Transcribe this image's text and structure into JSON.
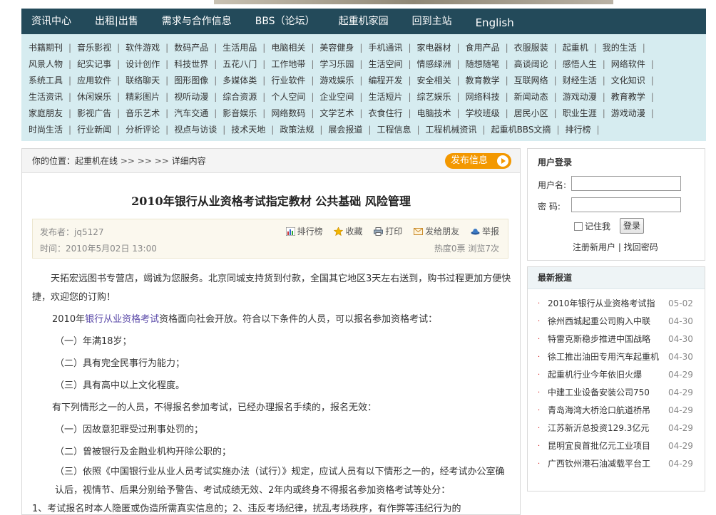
{
  "nav": {
    "items": [
      "资讯中心",
      "出租|出售",
      "需求与合作信息",
      "BBS（论坛）",
      "起重机家园",
      "回到主站",
      "English"
    ]
  },
  "categories": {
    "rows": [
      [
        "书籍期刊",
        "音乐影视",
        "软件游戏",
        "数码产品",
        "生活用品",
        "电脑相关",
        "美容健身",
        "手机通讯",
        "家电器材",
        "食用产品",
        "衣服服装",
        "起重机",
        "我的生活"
      ],
      [
        "风景人物",
        "纪实记事",
        "设计创作",
        "科技世界",
        "五花八门",
        "工作地带",
        "学习乐园",
        "生活空间",
        "情感绿洲",
        "随想随笔",
        "高谈阔论",
        "感悟人生",
        "网络软件"
      ],
      [
        "系统工具",
        "应用软件",
        "联络聊天",
        "图形图像",
        "多媒体类",
        "行业软件",
        "游戏娱乐",
        "编程开发",
        "安全相关",
        "教育教学",
        "互联网络",
        "财经生活",
        "文化知识"
      ],
      [
        "生活资讯",
        "休闲娱乐",
        "精彩图片",
        "视听动漫",
        "综合资源",
        "个人空间",
        "企业空间",
        "生活短片",
        "综艺娱乐",
        "网络科技",
        "新闻动态",
        "游戏动漫",
        "教育教学"
      ],
      [
        "家庭朋友",
        "影视广告",
        "音乐艺术",
        "汽车交通",
        "影音娱乐",
        "网络数码",
        "文学艺术",
        "衣食住行",
        "电脑技术",
        "学校班级",
        "居民小区",
        "职业生涯",
        "游戏动漫"
      ],
      [
        "时尚生活",
        "行业新闻",
        "分析评论",
        "视点与访谈",
        "技术天地",
        "政策法规",
        "展会报道",
        "工程信息",
        "工程机械资讯",
        "起重机BBS文摘",
        "排行榜"
      ]
    ]
  },
  "breadcrumb": {
    "prefix": "你的位置：起重机在线",
    "arrows": ">> >> >>",
    "current": "详细内容"
  },
  "post_button": "发布信息",
  "article": {
    "title": "2010年银行从业资格考试指定教材  公共基础  风险管理",
    "publisher": "发布者：jq5127",
    "time": "时间：2010年5月02日  13:00",
    "actions": [
      "排行榜",
      "收藏",
      "打印",
      "发给朋友",
      "举报"
    ],
    "stats": "热度0票  浏览7次",
    "p1": "天拓宏远图书专营店，竭诚为您服务。北京同城支持货到付款，全国其它地区3天左右送到，购书过程更加方便快捷，欢迎您的订购！",
    "p2_pre": "2010年",
    "p2_link": "银行从业资格考试",
    "p2_post": "资格面向社会开放。符合以下条件的人员，可以报名参加资格考试：",
    "c1": "（一）年满18岁；",
    "c2": "（二）具有完全民事行为能力；",
    "c3": "（三）具有高中以上文化程度。",
    "p3": "有下列情形之一的人员，不得报名参加考试，已经办理报名手续的，报名无效：",
    "d1": "（一）因故意犯罪受过刑事处罚的；",
    "d2": "（二）曾被银行及金融业机构开除公职的；",
    "d3": "（三）依照《中国银行业从业人员考试实施办法（试行）》规定，应试人员有以下情形之一的，经考试办公室确认后，视情节、后果分别给予警告、考试成绩无效、2年内或终身不得报名参加资格考试等处分：",
    "d4": "1、考试报名时本人隐匿或伪造所需真实信息的；2、违反考场纪律，扰乱考场秩序，有作弊等违纪行为的"
  },
  "login": {
    "title": "用户登录",
    "username_label": "用户名:",
    "password_label": "密  码:",
    "remember": "记住我",
    "submit": "登录",
    "register": "注册新用户",
    "divider": "|",
    "forgot": "找回密码"
  },
  "latest": {
    "title": "最新报道",
    "items": [
      {
        "text": "2010年银行从业资格考试指",
        "date": "05-02"
      },
      {
        "text": "徐州西城起重公司购入中联",
        "date": "04-30"
      },
      {
        "text": "特雷克斯稳步推进中国战略",
        "date": "04-30"
      },
      {
        "text": "徐工推出油田专用汽车起重机",
        "date": "04-30"
      },
      {
        "text": "起重机行业今年依旧火爆",
        "date": "04-29"
      },
      {
        "text": "中建工业设备安装公司750",
        "date": "04-29"
      },
      {
        "text": "青岛海湾大桥沧口航道桥吊",
        "date": "04-29"
      },
      {
        "text": "江苏新沂总投资129.3亿元",
        "date": "04-29"
      },
      {
        "text": "昆明宜良首批亿元工业项目",
        "date": "04-29"
      },
      {
        "text": "广西钦州港石油减载平台工",
        "date": "04-29"
      }
    ]
  }
}
